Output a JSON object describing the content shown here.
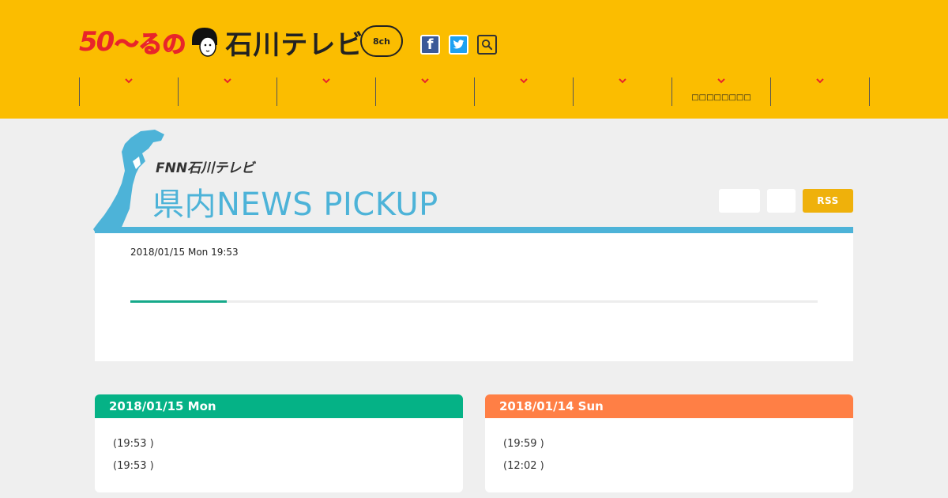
{
  "header": {
    "logo": {
      "anniversary": "50",
      "tilde_runo": "〜るの",
      "station": "石川テレビ",
      "channel": "8ch"
    },
    "social": {
      "facebook": "f",
      "twitter": "t",
      "search": "search-icon"
    },
    "nav_items": [
      {
        "label": ""
      },
      {
        "label": ""
      },
      {
        "label": ""
      },
      {
        "label": ""
      },
      {
        "label": ""
      },
      {
        "label": ""
      },
      {
        "label": "□□□□□□□□"
      },
      {
        "label": ""
      }
    ]
  },
  "title": {
    "brand": "FNN石川テレビ",
    "heading": "県内NEWS  PICKUP",
    "rss_label": "RSS"
  },
  "pickup": {
    "datetime": "2018/01/15 Mon 19:53",
    "progress": 0.14
  },
  "cards": [
    {
      "date": "2018/01/15 Mon",
      "items": [
        "(19:53 )",
        "(19:53 )"
      ]
    },
    {
      "date": "2018/01/14 Sun",
      "items": [
        "(19:59 )",
        "(12:02 )"
      ]
    }
  ],
  "colors": {
    "header_bg": "#fbbd00",
    "accent_blue": "#4db3d8",
    "green": "#05b286",
    "orange": "#ff7f45",
    "rss": "#efb10b"
  }
}
